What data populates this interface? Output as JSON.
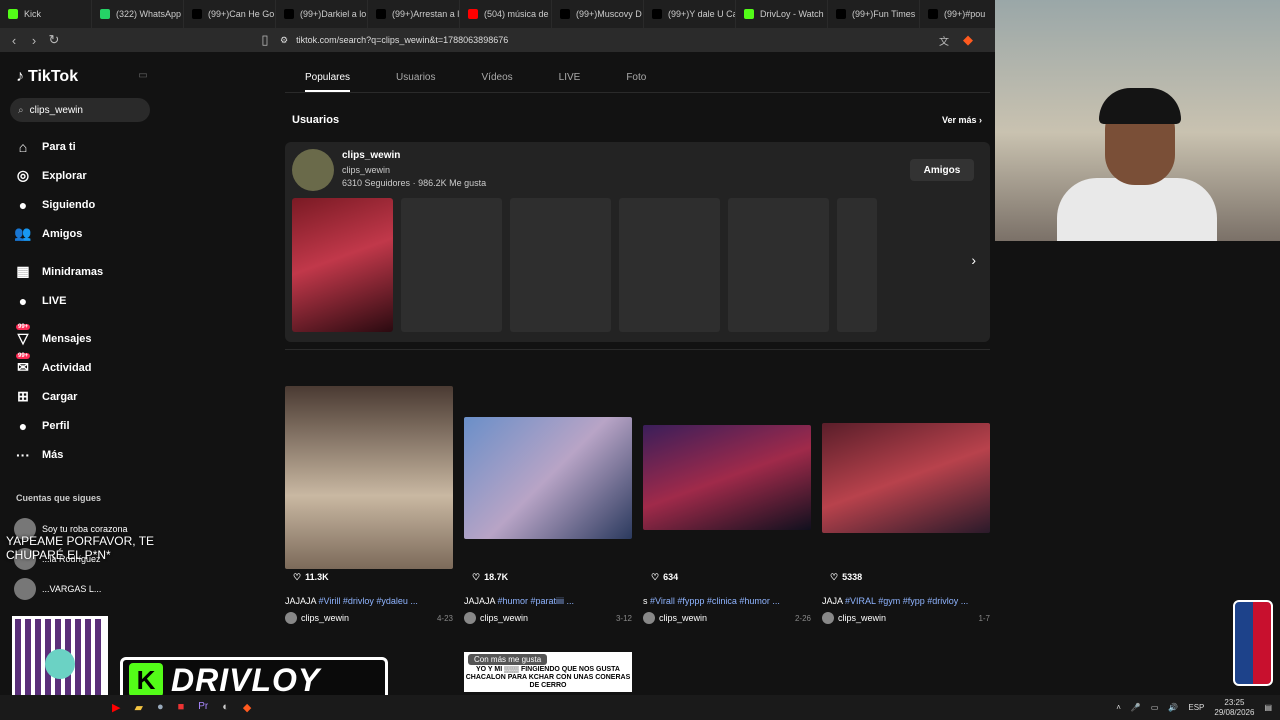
{
  "browser": {
    "tabs": [
      {
        "title": "Kick",
        "color": "#53fc18"
      },
      {
        "title": "(322) WhatsApp",
        "color": "#25d366"
      },
      {
        "title": "(99+)Can He Go",
        "color": "#000000"
      },
      {
        "title": "(99+)Darkiel a lo",
        "color": "#000000"
      },
      {
        "title": "(99+)Arrestan a l",
        "color": "#000000"
      },
      {
        "title": "(504) música de",
        "color": "#ff0000"
      },
      {
        "title": "(99+)Muscovy D",
        "color": "#000000"
      },
      {
        "title": "(99+)Y dale U Ca",
        "color": "#000000"
      },
      {
        "title": "DrivLoy - Watch",
        "color": "#53fc18"
      },
      {
        "title": "(99+)Fun Times",
        "color": "#000000"
      },
      {
        "title": "(99+)#pou",
        "color": "#000000"
      }
    ],
    "url": "tiktok.com/search?q=clips_wewin&t=1788063898676"
  },
  "sidebar": {
    "logo": "TikTok",
    "search_value": "clips_wewin",
    "nav": [
      {
        "label": "Para ti",
        "icon": "home-icon",
        "glyph": "⌂",
        "badge": ""
      },
      {
        "label": "Explorar",
        "icon": "compass-icon",
        "glyph": "◎",
        "badge": ""
      },
      {
        "label": "Siguiendo",
        "icon": "following-avatar-icon",
        "glyph": "●",
        "badge": ""
      },
      {
        "label": "Amigos",
        "icon": "friends-icon",
        "glyph": "👥",
        "badge": ""
      },
      {
        "label": "Minidramas",
        "icon": "film-icon",
        "glyph": "▦",
        "badge": ""
      },
      {
        "label": "LIVE",
        "icon": "live-icon",
        "glyph": "●",
        "badge": ""
      },
      {
        "label": "Mensajes",
        "icon": "messages-icon",
        "glyph": "▽",
        "badge": "99+"
      },
      {
        "label": "Actividad",
        "icon": "activity-icon",
        "glyph": "✉",
        "badge": "99+"
      },
      {
        "label": "Cargar",
        "icon": "upload-icon",
        "glyph": "⊞",
        "badge": ""
      },
      {
        "label": "Perfil",
        "icon": "profile-avatar-icon",
        "glyph": "●",
        "badge": ""
      },
      {
        "label": "Más",
        "icon": "more-icon",
        "glyph": "···",
        "badge": ""
      }
    ],
    "following_title": "Cuentas que sigues",
    "following": [
      {
        "name": "Soy tu roba corazona"
      },
      {
        "name": "...la Rodríguez"
      },
      {
        "name": "...VARGAS L..."
      }
    ]
  },
  "main": {
    "tabs": [
      "Populares",
      "Usuarios",
      "Vídeos",
      "LIVE",
      "Foto"
    ],
    "section_title": "Usuarios",
    "see_more": "Ver más",
    "user": {
      "name": "clips_wewin",
      "handle": "clips_wewin",
      "followers": "6310 Seguidores",
      "likes": "986.2K Me gusta",
      "button": "Amigos"
    },
    "videos": [
      {
        "likes": "11.3K",
        "title_plain": "JAJAJA ",
        "title_tags": "#Virill #drivloy #ydaleu ...",
        "author": "clips_wewin",
        "date": "4-23"
      },
      {
        "likes": "18.7K",
        "title_plain": "JAJAJA ",
        "title_tags": "#humor #paratiiii ...",
        "author": "clips_wewin",
        "date": "3-12"
      },
      {
        "likes": "634",
        "title_plain": "s ",
        "title_tags": "#Virall #fyppp #clinica #humor ...",
        "author": "clips_wewin",
        "date": "2-26"
      },
      {
        "likes": "5338",
        "title_plain": "JAJA ",
        "title_tags": "#VIRAL #gym #fypp #drivloy ...",
        "author": "clips_wewin",
        "date": "1-7"
      }
    ],
    "row2_label": "Con más me gusta",
    "row2_caption": "YO Y MI ▒▒▒ FINGIENDO QUE NOS GUSTA CHACALON PARA KCHAR CON UNAS CONERAS DE CERRO"
  },
  "overlay": {
    "text": "YAPEAME PORFAVOR, TE CHUPARÉ EL P*N*",
    "banner": "DRIVLOY",
    "kick_letter": "K"
  },
  "taskbar": {
    "lang": "ESP",
    "time": "23:25",
    "date": "29/08/2026"
  }
}
